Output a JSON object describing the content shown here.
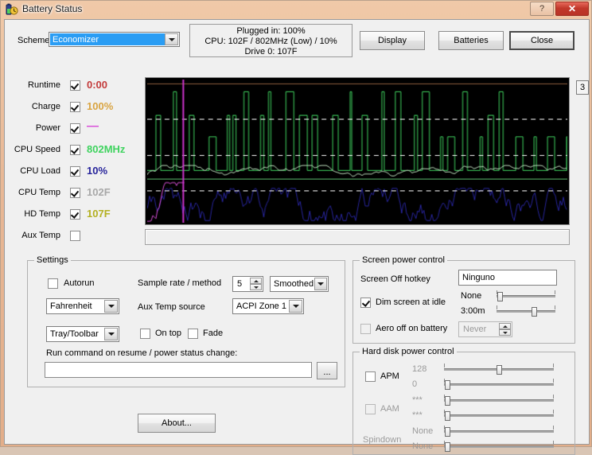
{
  "window": {
    "title": "Battery Status",
    "help_label": "?",
    "close_label": "✕"
  },
  "toolbar": {
    "scheme_label": "Scheme",
    "scheme_value": "Economizer",
    "display_label": "Display",
    "batteries_label": "Batteries",
    "close_label": "Close"
  },
  "status": {
    "line1": "Plugged in: 100%",
    "line2": "CPU: 102F / 802MHz (Low) / 10%",
    "line3": "Drive 0: 107F"
  },
  "metrics": [
    {
      "label": "Runtime",
      "checked": true,
      "value": "0:00",
      "color": "#c33a3a"
    },
    {
      "label": "Charge",
      "checked": true,
      "value": "100%",
      "color": "#d9a441"
    },
    {
      "label": "Power",
      "checked": true,
      "value": "—",
      "color": "#d94fd9"
    },
    {
      "label": "CPU Speed",
      "checked": true,
      "value": "802MHz",
      "color": "#3fd35f"
    },
    {
      "label": "CPU Load",
      "checked": true,
      "value": "10%",
      "color": "#27249b"
    },
    {
      "label": "CPU Temp",
      "checked": true,
      "value": "102F",
      "color": "#a8a8a8"
    },
    {
      "label": "HD Temp",
      "checked": true,
      "value": "107F",
      "color": "#b3b021"
    },
    {
      "label": "Aux Temp",
      "checked": false,
      "value": "",
      "color": "#000000"
    }
  ],
  "graph": {
    "badge": "3",
    "background": "#000000",
    "gridline_color": "#ffffff",
    "series_colors": {
      "cpu_speed": "#3fd35f",
      "cpu_load": "#27249b",
      "power": "#d94fd9",
      "hd_temp": "#b3b021",
      "cpu_temp": "#b9b9b9",
      "charge": "#8a5a3a",
      "cursor": "#cc33cc"
    }
  },
  "settings": {
    "title": "Settings",
    "autorun_label": "Autorun",
    "autorun_checked": false,
    "temp_unit": "Fahrenheit",
    "display_mode": "Tray/Toolbar",
    "sample_rate_label": "Sample rate / method",
    "sample_rate_value": "5",
    "sample_method": "Smoothed",
    "aux_temp_label": "Aux Temp source",
    "aux_temp_source": "ACPI Zone 1",
    "ontop_label": "On top",
    "ontop_checked": false,
    "fade_label": "Fade",
    "fade_checked": false,
    "run_command_label": "Run command on resume / power status change:",
    "run_command_value": "",
    "browse_label": "...",
    "about_label": "About..."
  },
  "screen_power": {
    "title": "Screen power control",
    "hotkey_label": "Screen Off hotkey",
    "hotkey_value": "Ninguno",
    "dim_label": "Dim screen at idle",
    "dim_checked": true,
    "dim_ac_value": "None",
    "dim_dc_value": "3:00m",
    "aero_label": "Aero off on battery",
    "aero_checked": false,
    "aero_value": "Never"
  },
  "hdd_power": {
    "title": "Hard disk power control",
    "apm_label": "APM",
    "apm_checked": false,
    "apm_ac_value": "128",
    "apm_dc_value": "0",
    "aam_label": "AAM",
    "aam_checked": false,
    "aam_ac_value": "***",
    "aam_dc_value": "***",
    "spindown_label": "Spindown",
    "spindown_ac_value": "None",
    "spindown_dc_value": "None"
  }
}
